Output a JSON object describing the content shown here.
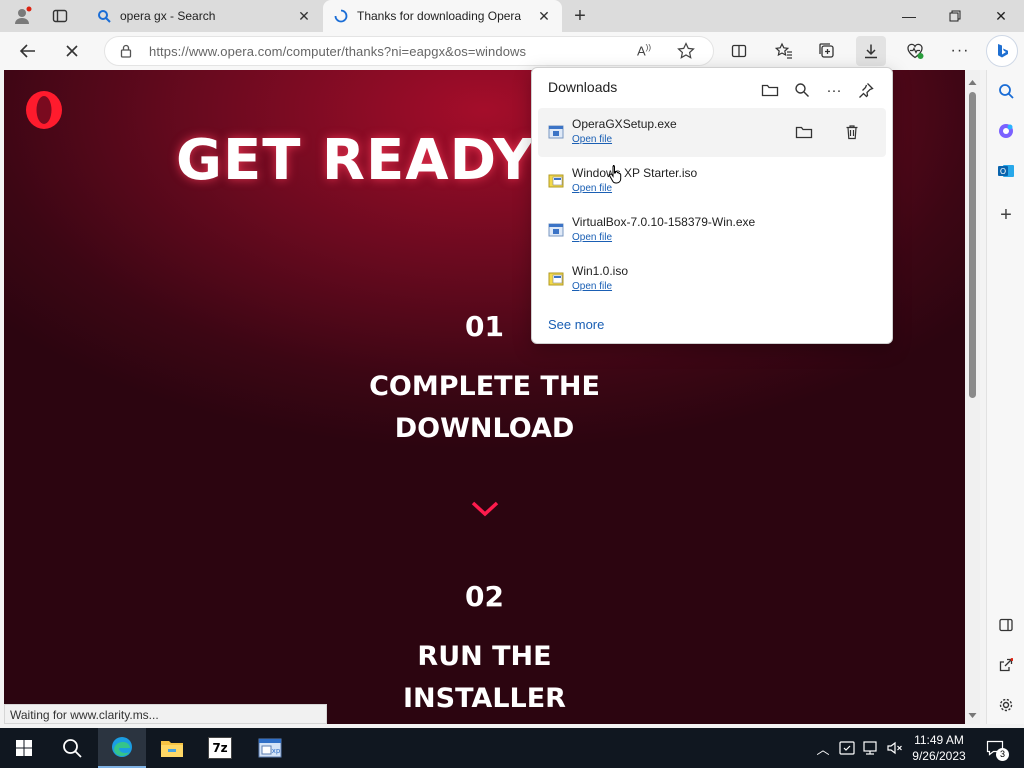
{
  "tabs": [
    {
      "title": "opera gx - Search",
      "active": false
    },
    {
      "title": "Thanks for downloading Opera",
      "active": true
    }
  ],
  "address": {
    "url": "https://www.opera.com/computer/thanks?ni=eapgx&os=windows"
  },
  "page": {
    "headline": "GET READY",
    "step1_num": "01",
    "step1_line1": "COMPLETE THE",
    "step1_line2": "DOWNLOAD",
    "step2_num": "02",
    "step2_line1": "RUN THE",
    "step2_line2": "INSTALLER"
  },
  "status_text": "Waiting for www.clarity.ms...",
  "downloads": {
    "title": "Downloads",
    "items": [
      {
        "name": "OperaGXSetup.exe",
        "action": "Open file",
        "icon": "exe-icon"
      },
      {
        "name": "Windows XP Starter.iso",
        "action": "Open file",
        "icon": "iso-icon"
      },
      {
        "name": "VirtualBox-7.0.10-158379-Win.exe",
        "action": "Open file",
        "icon": "exe-icon"
      },
      {
        "name": "Win1.0.iso",
        "action": "Open file",
        "icon": "iso-icon"
      }
    ],
    "see_more": "See more"
  },
  "taskbar": {
    "time": "11:49 AM",
    "date": "9/26/2023",
    "notification_count": "3"
  },
  "colors": {
    "opera_red": "#ff1b2d",
    "link_blue": "#1a5fb4",
    "page_bg": "#3c0614"
  }
}
